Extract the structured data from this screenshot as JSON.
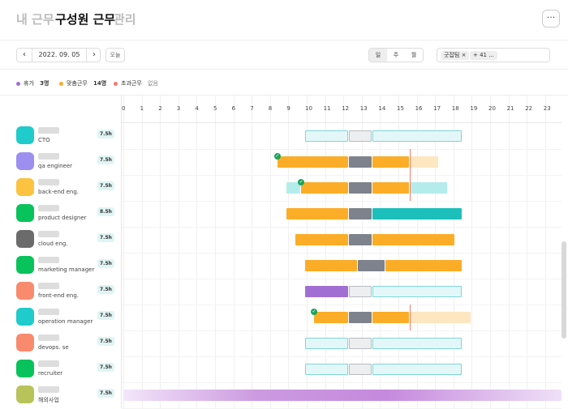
{
  "tabs": [
    {
      "label": "내 근무",
      "active": false
    },
    {
      "label": "구성원 근무",
      "active": true
    },
    {
      "label": "관리",
      "active": false
    }
  ],
  "more_label": "···",
  "date": "2022. 09. 05",
  "today_label": "오늘",
  "view_segments": [
    "일",
    "주",
    "월"
  ],
  "filter": {
    "chip": "굿잡팀",
    "count_chip": "+ 41 ..."
  },
  "legend": [
    {
      "label": "휴가",
      "value": "3명",
      "color": "#a16fd3"
    },
    {
      "label": "맞춤근무",
      "value": "14명",
      "color": "#fbad27"
    },
    {
      "label": "초과근무",
      "value": "없음",
      "color": "#f17c6c"
    }
  ],
  "hours": [
    "0",
    "1",
    "2",
    "3",
    "4",
    "5",
    "6",
    "7",
    "8",
    "9",
    "10",
    "11",
    "12",
    "13",
    "14",
    "15",
    "16",
    "17",
    "18",
    "19",
    "20",
    "21",
    "22",
    "23"
  ],
  "rows": [
    {
      "role": "CTO",
      "hours": "7.5h",
      "avatar": "#1fcbcb"
    },
    {
      "role": "qa engineer",
      "hours": "7.5h",
      "avatar": "#9c8ff0"
    },
    {
      "role": "back-end eng.",
      "hours": "7.5h",
      "avatar": "#fbc33f"
    },
    {
      "role": "product designer",
      "hours": "8.5h",
      "avatar": "#08c35b"
    },
    {
      "role": "cloud eng.",
      "hours": "7.5h",
      "avatar": "#6b6b6b"
    },
    {
      "role": "marketing manager",
      "hours": "7.5h",
      "avatar": "#08c35b"
    },
    {
      "role": "front-end eng.",
      "hours": "7.5h",
      "avatar": "#f88b6e"
    },
    {
      "role": "operation manager",
      "hours": "7.5h",
      "avatar": "#1fcbcb"
    },
    {
      "role": "devops. se",
      "hours": "7.5h",
      "avatar": "#f88b6e"
    },
    {
      "role": "recruiter",
      "hours": "7.5h",
      "avatar": "#08c35b"
    },
    {
      "role": "해외사업",
      "hours": "7.5h",
      "avatar": "#b8c35a"
    }
  ]
}
